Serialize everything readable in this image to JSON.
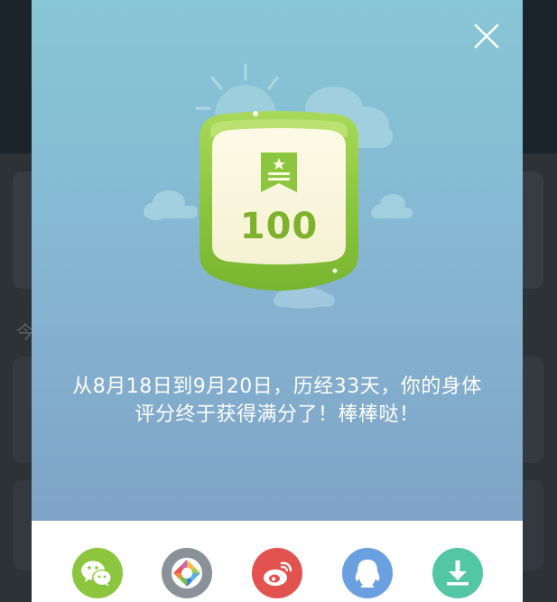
{
  "background": {
    "partial_text": "今"
  },
  "modal": {
    "badge": {
      "score": "100",
      "icon": "ribbon-star-icon"
    },
    "message": {
      "line1": "从8月18日到9月20日，历经33天，你的身体",
      "line2": "评分终于获得满分了！棒棒哒！"
    },
    "close_icon": "close-icon",
    "share": [
      {
        "name": "wechat",
        "icon": "wechat-icon",
        "color": "#8cc63f"
      },
      {
        "name": "moments",
        "icon": "wechat-moments-icon",
        "color": "#8a9198"
      },
      {
        "name": "weibo",
        "icon": "weibo-icon",
        "color": "#e2534f"
      },
      {
        "name": "qq",
        "icon": "qq-icon",
        "color": "#6a9fe0"
      },
      {
        "name": "download",
        "icon": "download-icon",
        "color": "#53c6a3"
      }
    ]
  },
  "colors": {
    "badge_green": "#8cc63f",
    "score_green": "#7eb22c",
    "sky_top": "#87c6d6",
    "sky_bottom": "#7fa3c6"
  }
}
